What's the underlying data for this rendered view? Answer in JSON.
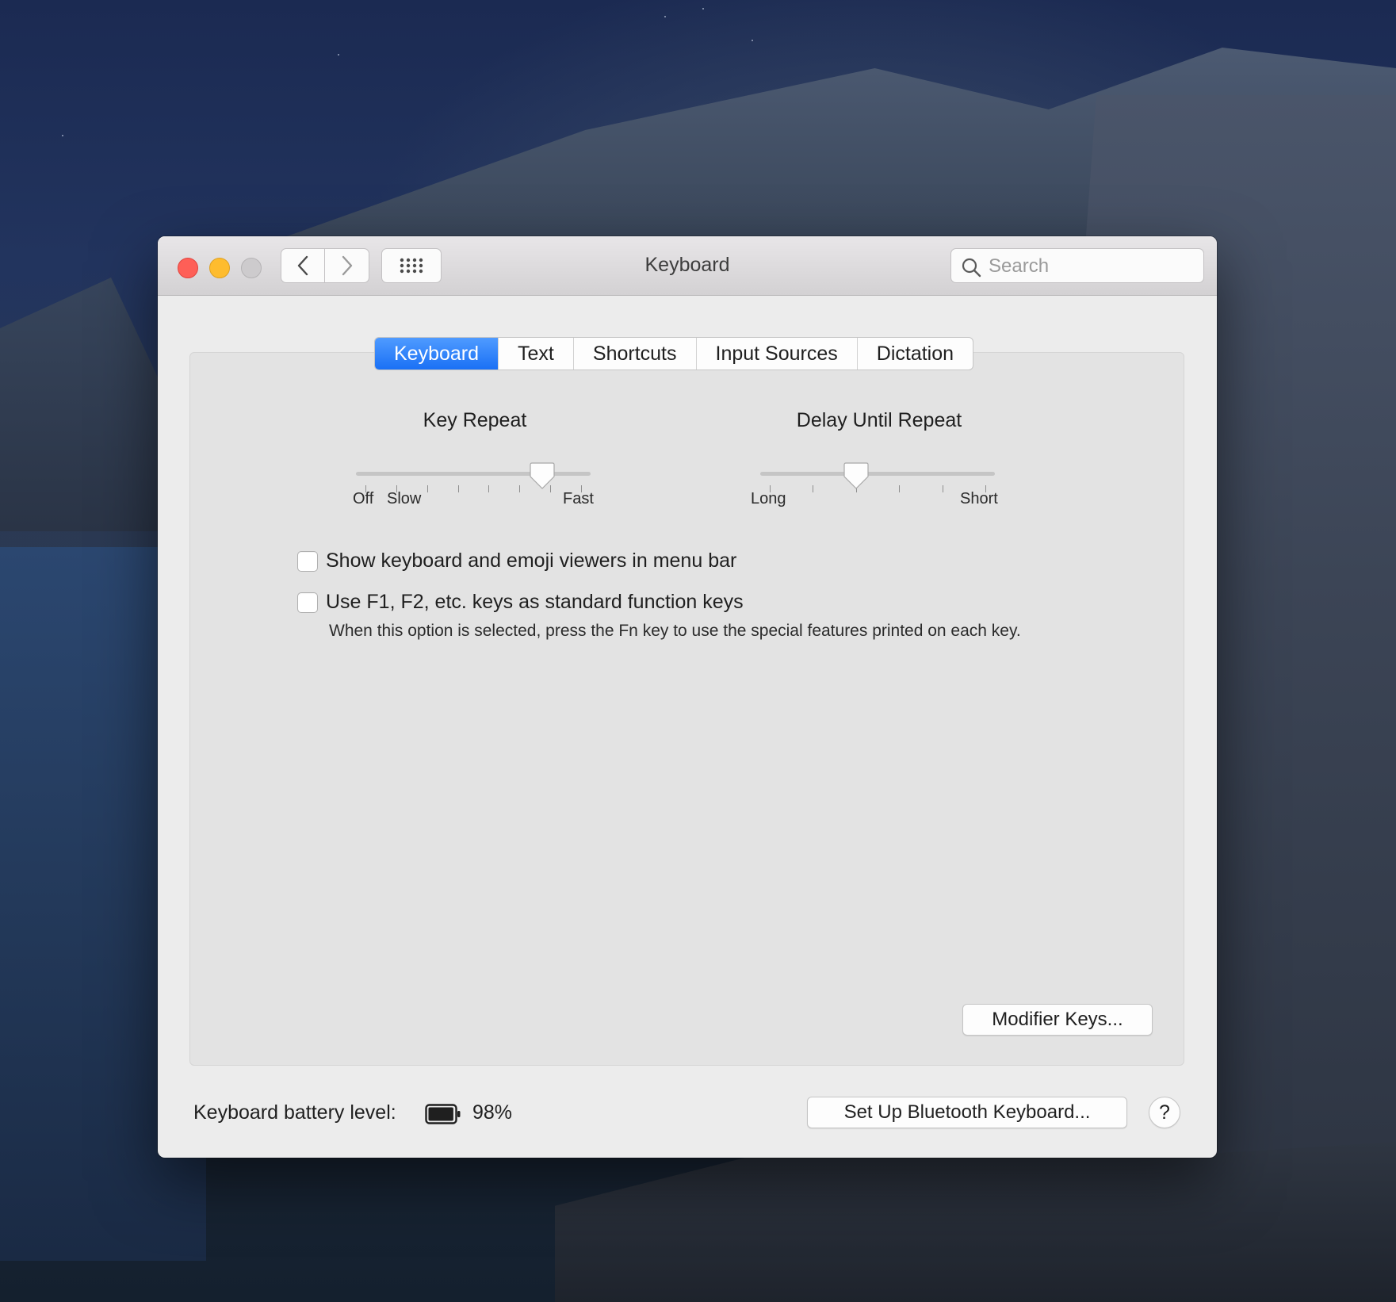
{
  "window": {
    "title": "Keyboard"
  },
  "search": {
    "placeholder": "Search"
  },
  "tabs": [
    {
      "label": "Keyboard",
      "active": true
    },
    {
      "label": "Text",
      "active": false
    },
    {
      "label": "Shortcuts",
      "active": false
    },
    {
      "label": "Input Sources",
      "active": false
    },
    {
      "label": "Dictation",
      "active": false
    }
  ],
  "key_repeat": {
    "title": "Key Repeat",
    "labels": {
      "off": "Off",
      "slow": "Slow",
      "fast": "Fast"
    },
    "tick_count": 8,
    "value_fraction": 0.82
  },
  "delay_until_repeat": {
    "title": "Delay Until Repeat",
    "labels": {
      "long": "Long",
      "short": "Short"
    },
    "tick_count": 6,
    "value_fraction": 0.4
  },
  "options": [
    {
      "label": "Show keyboard and emoji viewers in menu bar",
      "checked": false
    },
    {
      "label": "Use F1, F2, etc. keys as standard function keys",
      "checked": false
    }
  ],
  "function_keys_help": "When this option is selected, press the Fn key to use the special features printed on each key.",
  "buttons": {
    "modifier_keys": "Modifier Keys...",
    "setup_bluetooth": "Set Up Bluetooth Keyboard...",
    "help": "?"
  },
  "battery": {
    "label": "Keyboard battery level:",
    "value": "98%",
    "fraction": 0.98
  },
  "icons": [
    "close-button",
    "minimize-button",
    "zoom-button",
    "chevron-left-icon",
    "chevron-right-icon",
    "grid-icon",
    "search-icon",
    "battery-icon"
  ],
  "colors": {
    "accent": "#1a70f5",
    "close": "#fe5f57",
    "minimize": "#febc2e"
  }
}
